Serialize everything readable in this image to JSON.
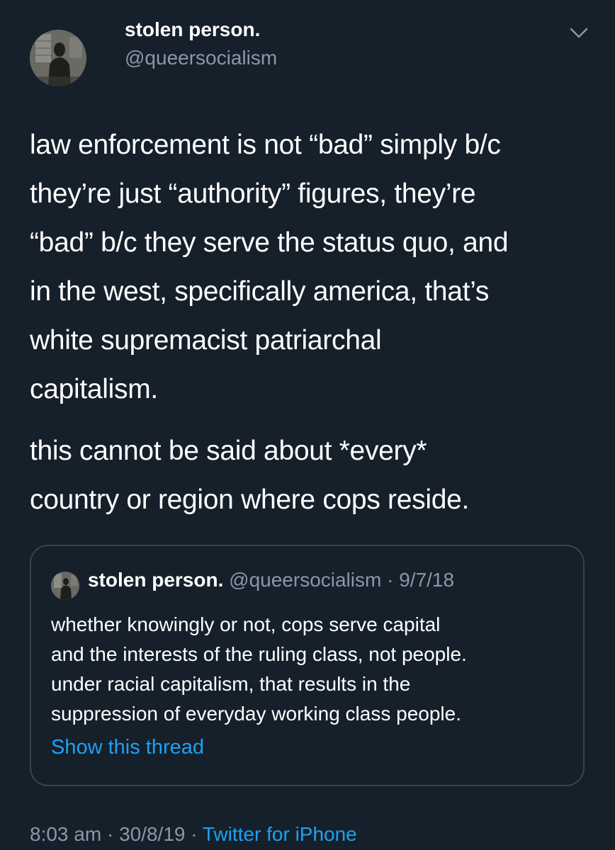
{
  "tweet": {
    "display_name": "stolen person.",
    "handle": "@queersocialism",
    "avatar_icon": "profile-photo-silhouette",
    "menu_icon": "chevron-down-icon",
    "paragraphs": [
      "law enforcement is not “bad” simply b/c\nthey’re just “authority” figures, they’re\n“bad” b/c they serve the status quo, and\nin the west, specifically america, that’s\nwhite supremacist patriarchal\ncapitalism.",
      "this cannot be said about *every*\ncountry or region where cops reside."
    ],
    "time": "8:03 am",
    "date": "30/8/19",
    "source": "Twitter for iPhone",
    "separator": " · "
  },
  "quote": {
    "display_name": "stolen person.",
    "handle": "@queersocialism",
    "date": "9/7/18",
    "separator": " · ",
    "text_lines": [
      "whether knowingly or not, cops serve capital",
      "and the interests of the ruling class, not people.",
      "under racial capitalism, that results in the",
      "suppression of everyday working class people."
    ],
    "show_thread_label": "Show this thread"
  },
  "colors": {
    "background": "#15202b",
    "text": "#ffffff",
    "secondary_text": "#8899a6",
    "link": "#1da1f2",
    "border": "#38444d"
  }
}
